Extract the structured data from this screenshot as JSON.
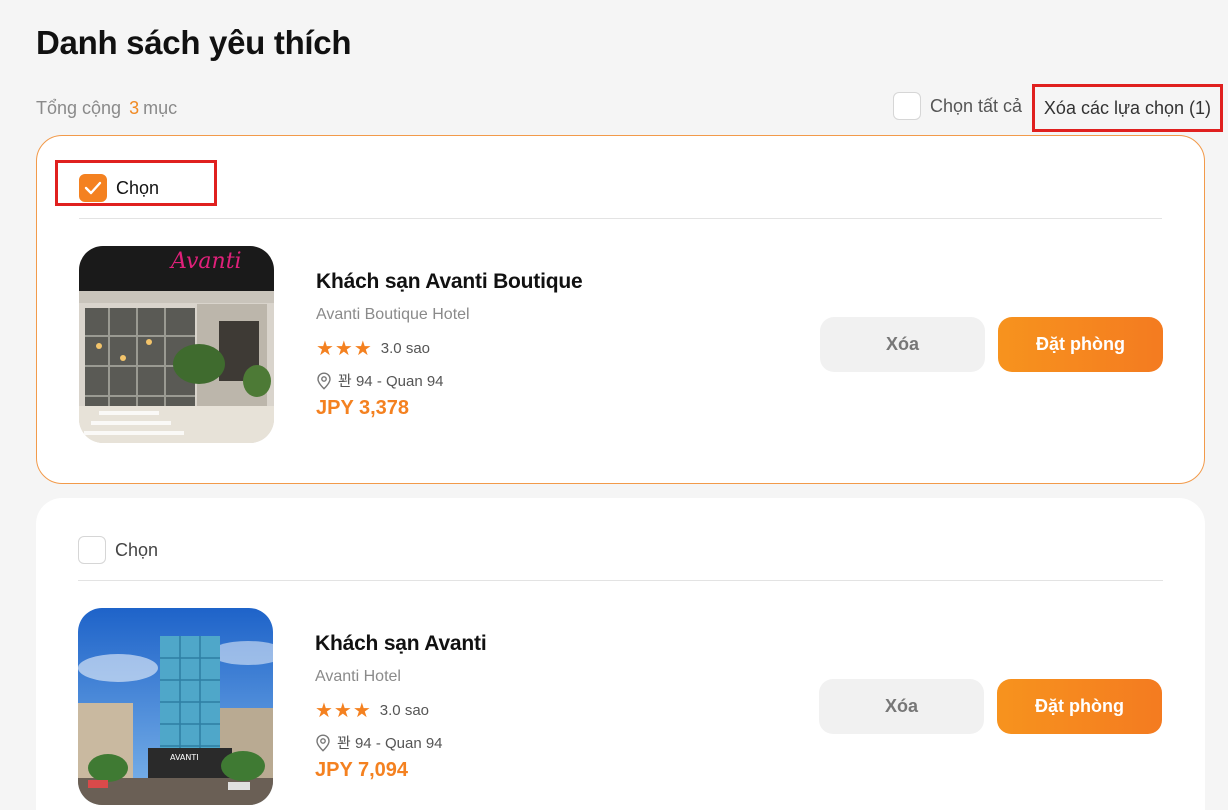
{
  "page": {
    "title": "Danh sách yêu thích",
    "summary_prefix": "Tổng cộng",
    "summary_count": "3",
    "summary_suffix": "mục",
    "select_all_label": "Chọn tất cả",
    "select_all_checked": false,
    "clear_selected_label": "Xóa các lựa chọn (1)"
  },
  "colors": {
    "accent": "#f48120",
    "highlight": "#e0201f"
  },
  "items": [
    {
      "select_label": "Chọn",
      "checked": true,
      "name": "Khách sạn Avanti Boutique",
      "subname": "Avanti Boutique Hotel",
      "stars": "★★★",
      "rating": "3.0 sao",
      "location": "꽌 94 - Quan 94",
      "price": "JPY 3,378",
      "delete_label": "Xóa",
      "book_label": "Đặt phòng",
      "image_icon": "hotel-lobby-photo"
    },
    {
      "select_label": "Chọn",
      "checked": false,
      "name": "Khách sạn Avanti",
      "subname": "Avanti Hotel",
      "stars": "★★★",
      "rating": "3.0 sao",
      "location": "꽌 94 - Quan 94",
      "price": "JPY 7,094",
      "delete_label": "Xóa",
      "book_label": "Đặt phòng",
      "image_icon": "hotel-tower-photo"
    }
  ]
}
